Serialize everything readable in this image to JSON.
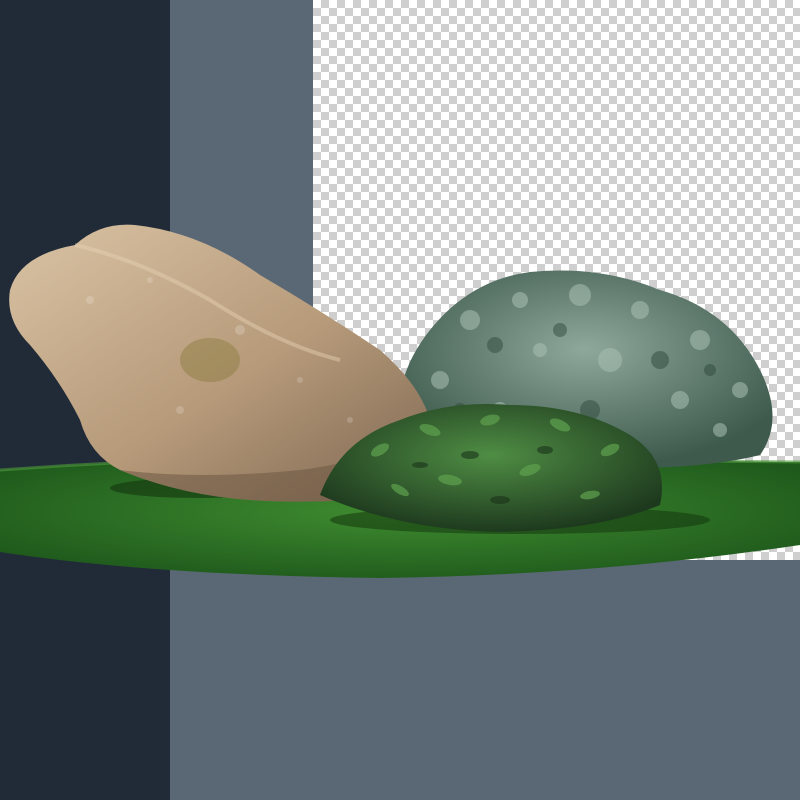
{
  "colors": {
    "panel_dark": "#212b38",
    "panel_slate": "#5a6876",
    "grass_dark": "#1f5a1c",
    "grass_light": "#3f8c30",
    "rock_base": "#b69a7a",
    "rock_shadow": "#7d6650",
    "rock_highlight": "#d9c3a4",
    "shrub_silver": "#6f8c7f",
    "shrub_dark": "#2a4a2a",
    "shrub_leaf": "#3f7a3a"
  },
  "elements": {
    "rock": "boulder",
    "shrub_back": "silver-green-shrub",
    "shrub_front": "dark-green-shrub",
    "ground": "grass-patch",
    "background": "transparency-checkerboard"
  }
}
